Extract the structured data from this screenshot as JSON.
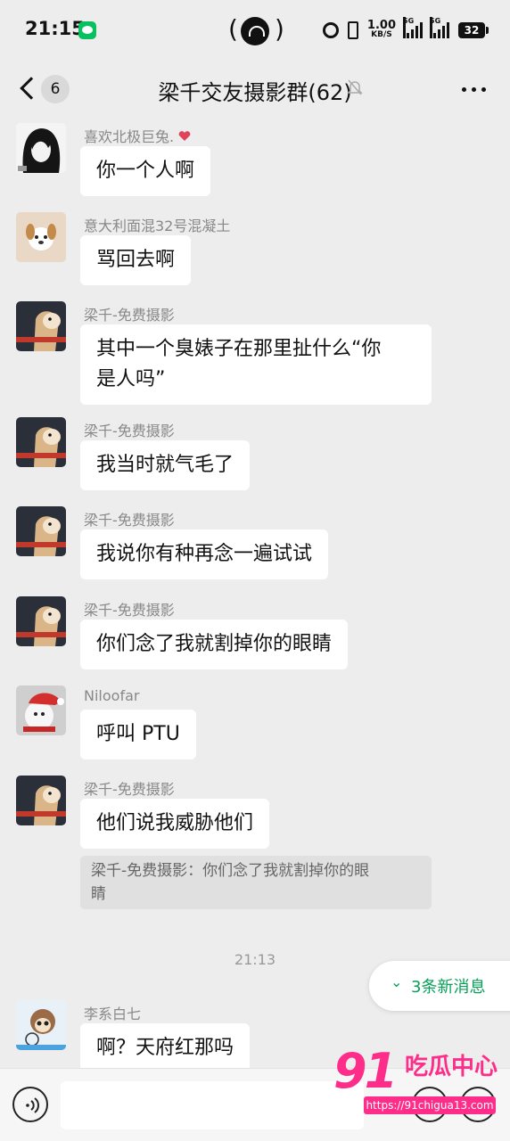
{
  "status_bar": {
    "time": "21:15",
    "speed_value": "1.00",
    "speed_unit": "KB/S",
    "signal_1": "5G",
    "signal_2": "5G",
    "battery": "32"
  },
  "nav": {
    "back_count": "6",
    "title": "梁千交友摄影群(62)"
  },
  "messages": [
    {
      "sender": "喜欢北极巨兔.",
      "text": "你一个人啊"
    },
    {
      "sender": "意大利面混32号混凝土",
      "text": "骂回去啊"
    },
    {
      "sender": "梁千-免费摄影",
      "text_line1": "其中一个臭婊子在那里扯什么“你",
      "text_line2": "是人吗”"
    },
    {
      "sender": "梁千-免费摄影",
      "text": "我当时就气毛了"
    },
    {
      "sender": "梁千-免费摄影",
      "text": "我说你有种再念一遍试试"
    },
    {
      "sender": "梁千-免费摄影",
      "text": "你们念了我就割掉你的眼睛"
    },
    {
      "sender": "Niloofar",
      "text": "呼叫 PTU"
    },
    {
      "sender": "梁千-免费摄影",
      "text": "他们说我威胁他们",
      "quote_line1": "梁千-免费摄影：你们念了我就割掉你的眼",
      "quote_line2": "睛"
    },
    {
      "sender": "李系白七",
      "text": "啊？天府红那吗"
    }
  ],
  "timestamp": "21:13",
  "new_messages": "3条新消息",
  "watermark": {
    "logo_number": "91",
    "logo_text": "吃瓜中心",
    "url": "https://91chigua13.com"
  },
  "colors": {
    "background": "#ededed",
    "bubble": "#ffffff",
    "accent_green": "#07a05a",
    "watermark_pink": "#ff2d8a"
  }
}
